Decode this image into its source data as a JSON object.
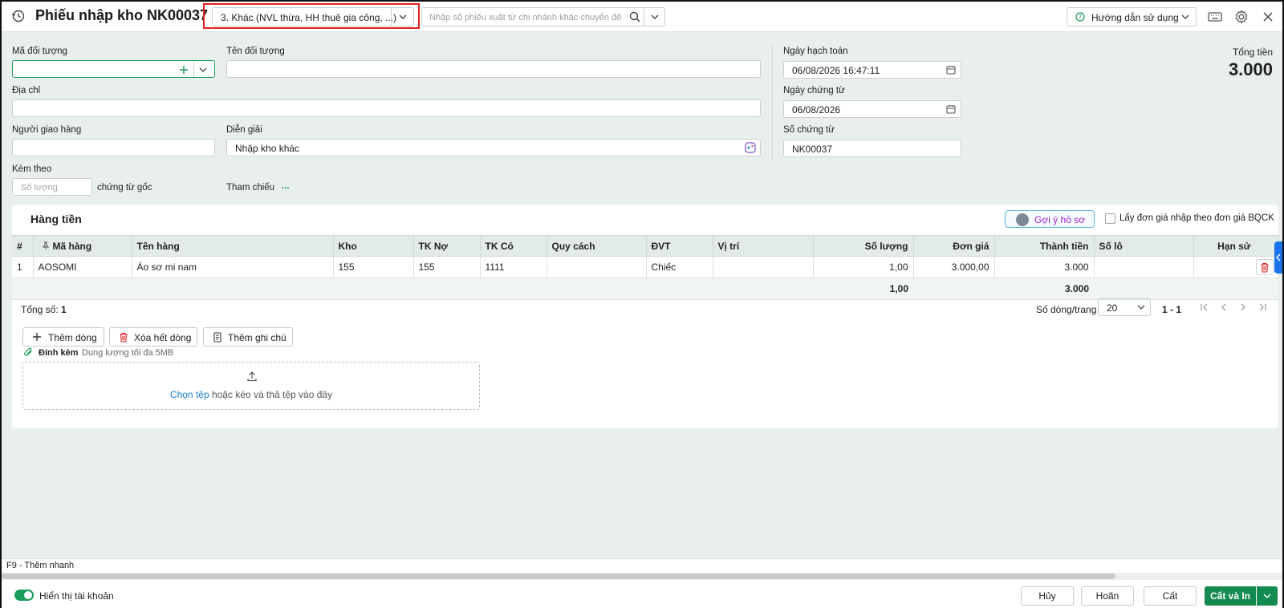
{
  "header": {
    "title": "Phiếu nhập kho NK00037",
    "type_value": "3. Khác (NVL thừa, HH thuê gia công, ...)",
    "search_placeholder": "Nhập số phiếu xuất từ chi nhánh khác chuyển đến",
    "help_label": "Hướng dẫn sử dụng"
  },
  "form": {
    "object_code_label": "Mã đối tượng",
    "object_name_label": "Tên đối tượng",
    "address_label": "Địa chỉ",
    "deliverer_label": "Người giao hàng",
    "description_label": "Diễn giải",
    "description_value": "Nhập kho khác",
    "attach_label": "Kèm theo",
    "qty_placeholder": "Số lượng",
    "original_docs": "chứng từ gốc",
    "reference_label": "Tham chiếu",
    "reference_value": "...",
    "posting_date_label": "Ngày hạch toán",
    "posting_date_value": "06/08/2026 16:47:11",
    "doc_date_label": "Ngày chứng từ",
    "doc_date_value": "06/08/2026",
    "doc_no_label": "Số chứng từ",
    "doc_no_value": "NK00037",
    "total_label": "Tổng tiền",
    "total_value": "3.000"
  },
  "items": {
    "title": "Hàng tiền",
    "suggest_label": "Gợi ý hồ sơ",
    "checkbox_label": "Lấy đơn giá nhập theo đơn giá BQCK",
    "columns": [
      "#",
      "Mã hàng",
      "Tên hàng",
      "Kho",
      "TK Nợ",
      "TK Có",
      "Quy cách",
      "ĐVT",
      "Vị trí",
      "Số lượng",
      "Đơn giá",
      "Thành tiền",
      "Số lô",
      "Hạn sử"
    ],
    "rows": [
      {
        "no": "1",
        "code": "AOSOMI",
        "name": "Áo sơ mi nam",
        "warehouse": "155",
        "debit": "155",
        "credit": "1111",
        "spec": "",
        "unit": "Chiếc",
        "location": "",
        "qty": "1,00",
        "price": "3.000,00",
        "amount": "3.000",
        "lot": "",
        "expiry": ""
      }
    ],
    "sum_qty": "1,00",
    "sum_amount": "3.000",
    "count_label": "Tổng số:",
    "count_value": "1",
    "rows_per_page_label": "Số dòng/trang",
    "rows_per_page_value": "20",
    "range": "1 - 1",
    "add_row": "Thêm dòng",
    "delete_all": "Xóa hết dòng",
    "add_note": "Thêm ghi chú",
    "attach_label": "Đính kèm",
    "attach_hint": "Dung lượng tối đa 5MB",
    "choose_file": "Chọn tệp",
    "drop_hint": " hoặc kéo và thả tệp vào đây"
  },
  "shortcut": "F9 - Thêm nhanh",
  "footer": {
    "toggle_label": "Hiển thị tài khoản",
    "cancel": "Hủy",
    "undo": "Hoãn",
    "save": "Cất",
    "save_close": "Cất và In"
  },
  "colors": {
    "accent": "#138a4f",
    "highlight": "#e02020",
    "header_bg": "#e3ebe8"
  }
}
